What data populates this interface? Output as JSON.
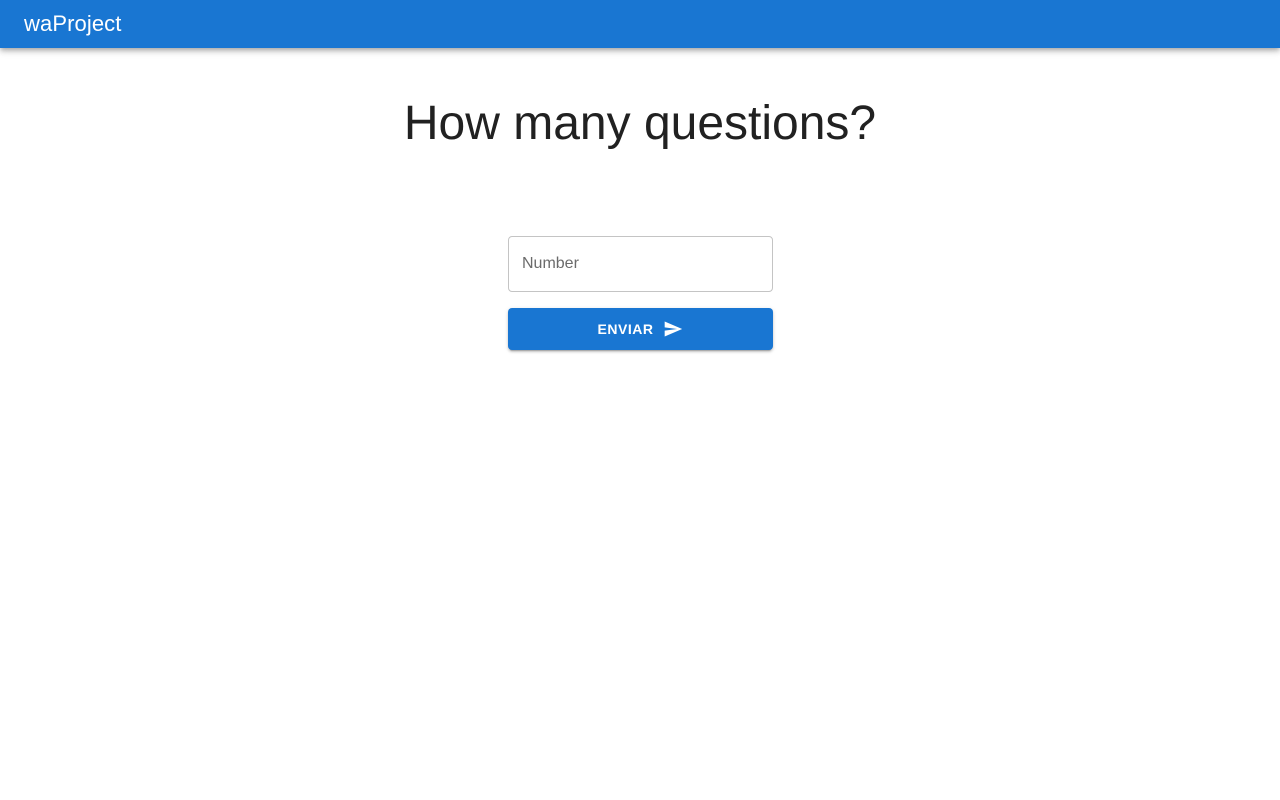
{
  "app_bar": {
    "title": "waProject",
    "color": "#1976d2"
  },
  "main": {
    "title": "How many questions?",
    "number_input": {
      "placeholder": "Number",
      "value": ""
    },
    "submit_button": {
      "label": "ENVIAR",
      "icon": "send-icon",
      "color": "#1976d2"
    }
  }
}
